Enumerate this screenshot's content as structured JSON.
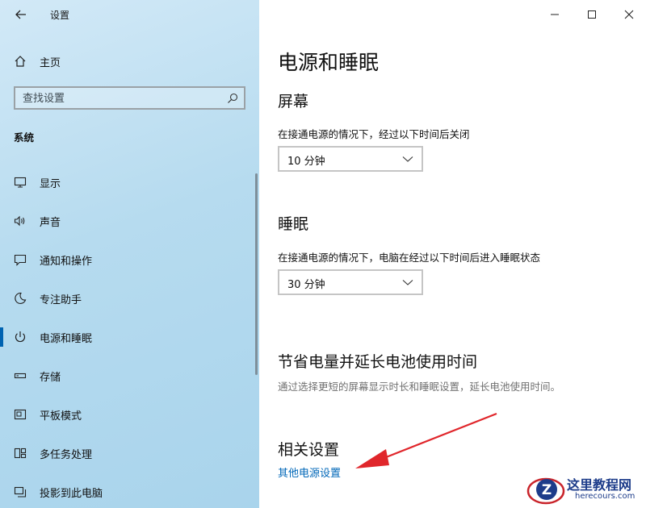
{
  "window": {
    "title": "设置"
  },
  "sidebar": {
    "home_label": "主页",
    "search_placeholder": "查找设置",
    "section_label": "系统",
    "items": [
      {
        "label": "显示",
        "icon": "monitor-icon"
      },
      {
        "label": "声音",
        "icon": "speaker-icon"
      },
      {
        "label": "通知和操作",
        "icon": "notification-icon"
      },
      {
        "label": "专注助手",
        "icon": "moon-icon"
      },
      {
        "label": "电源和睡眠",
        "icon": "power-icon",
        "selected": true
      },
      {
        "label": "存储",
        "icon": "storage-icon"
      },
      {
        "label": "平板模式",
        "icon": "tablet-icon"
      },
      {
        "label": "多任务处理",
        "icon": "multitask-icon"
      },
      {
        "label": "投影到此电脑",
        "icon": "project-icon"
      }
    ]
  },
  "main": {
    "title": "电源和睡眠",
    "screen": {
      "heading": "屏幕",
      "description": "在接通电源的情况下，经过以下时间后关闭",
      "dropdown_value": "10 分钟"
    },
    "sleep": {
      "heading": "睡眠",
      "description": "在接通电源的情况下，电脑在经过以下时间后进入睡眠状态",
      "dropdown_value": "30 分钟"
    },
    "battery": {
      "heading": "节省电量并延长电池使用时间",
      "description": "通过选择更短的屏幕显示时长和睡眠设置，延长电池使用时间。"
    },
    "related": {
      "heading": "相关设置",
      "link": "其他电源设置"
    }
  },
  "colors": {
    "accent": "#0063b1",
    "link": "#0067b8",
    "annotation_arrow": "#e0262b"
  },
  "watermark": {
    "logo_letter": "Z",
    "text_cn": "这里教程网",
    "text_en": "herecours.com"
  }
}
